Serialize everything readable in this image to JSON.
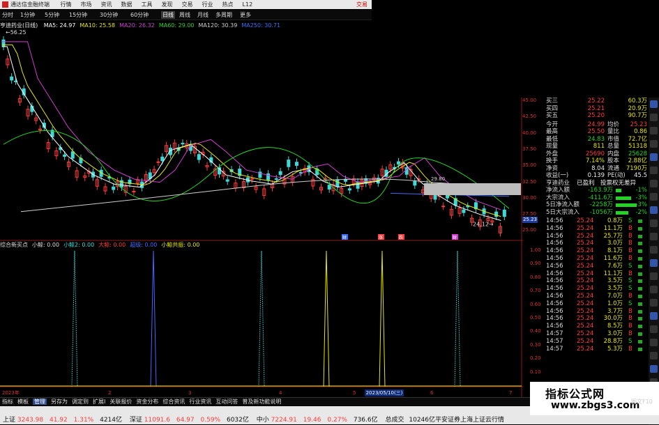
{
  "titlebar": {
    "app_title": "通达信金融终端",
    "trade": "交易"
  },
  "menu": [
    "行情",
    "市场",
    "资讯",
    "数据",
    "工具",
    "发现",
    "交易",
    "行业",
    "热点",
    "L12"
  ],
  "periods": [
    "分时",
    "1分钟",
    "5分钟",
    "15分钟",
    "30分钟",
    "60分钟",
    "日线",
    "周线",
    "月线",
    "多周期",
    "更多"
  ],
  "stock_label": "亨迪药业(日线)",
  "ma_legend": [
    {
      "label": "MA5: 24.97",
      "color": "#ffffff"
    },
    {
      "label": "MA10: 25.58",
      "color": "#e8e800"
    },
    {
      "label": "MA20: 26.32",
      "color": "#d23cd2"
    },
    {
      "label": "MA60: 29.00",
      "color": "#23d323"
    },
    {
      "label": "MA120: 30.39",
      "color": "#cfcfcf"
    },
    {
      "label": "MA250: 30.71",
      "color": "#3a6cff"
    }
  ],
  "high_label": "56.25",
  "low_label": "24.12",
  "hl_box_label": "29.80",
  "price_axis": [
    "45.00",
    "42.50",
    "40.00",
    "37.50",
    "35.00",
    "32.50",
    "30.00",
    "27.50",
    "25.00"
  ],
  "ind_axis": [
    "1.00",
    "0.90",
    "0.80",
    "0.70",
    "0.60",
    "0.50",
    "0.40",
    "0.30",
    "0.20",
    "0.10",
    "0.00"
  ],
  "current_price_tag": "25.23",
  "indicator_legend": [
    {
      "label": "综合新买点",
      "color": "#ddd"
    },
    {
      "label": "小鲸: 0.00",
      "color": "#ddd"
    },
    {
      "label": "小鲸2: 0.00",
      "color": "#3fd8d8"
    },
    {
      "label": "大鲸: 0.00",
      "color": "#ff3b3b"
    },
    {
      "label": "超级: 0.00",
      "color": "#3a6cff"
    },
    {
      "label": "小鲸共振: 0.00",
      "color": "#e8e800"
    }
  ],
  "month_labels": [
    "2023年",
    "2",
    "3",
    "4",
    "5",
    "6",
    "7"
  ],
  "date_box": "2023/05/10(三)",
  "event_marks": [
    "财",
    "涨",
    "跌",
    "财"
  ],
  "quote": {
    "asks": [
      [
        "买三",
        "25.22",
        "60.3万"
      ],
      [
        "买四",
        "25.21",
        "20.9万"
      ],
      [
        "买五",
        "25.20",
        "90.7万"
      ]
    ],
    "rows": [
      [
        "今开",
        "24.99",
        "均价",
        "25.23"
      ],
      [
        "最高",
        "25.50",
        "量比",
        "0.86"
      ],
      [
        "最低",
        "24.83",
        "市值",
        "72.7亿"
      ],
      [
        "现量",
        "811",
        "总量",
        "51318"
      ],
      [
        "外盘",
        "25690",
        "内盘",
        "25628"
      ],
      [
        "换手",
        "7.14%",
        "股本",
        "2.88亿"
      ],
      [
        "净资",
        "8.04",
        "流通",
        "7190万"
      ],
      [
        "收益(一)",
        "0.139",
        "PE(动)",
        "45.5"
      ]
    ],
    "stock_name": "亨迪药业",
    "profit": "已盈利",
    "vote": "投票权无差异",
    "flows": [
      [
        "净流入额",
        "-163.9万",
        "-1%"
      ],
      [
        "大宗流入",
        "-411.6万",
        "-3%"
      ],
      [
        "5日净流入额",
        "-2258万",
        "-3%"
      ],
      [
        "5日大宗流入",
        "-1056万",
        "-2%"
      ]
    ],
    "ticks": [
      [
        "14:56",
        "25.24",
        "0.8万",
        "S"
      ],
      [
        "14:56",
        "25.24",
        "11.1万",
        "B"
      ],
      [
        "14:56",
        "25.24",
        "25.7万",
        "B"
      ],
      [
        "14:56",
        "25.24",
        "3.0万",
        "B"
      ],
      [
        "14:56",
        "25.24",
        "8.1万",
        "B"
      ],
      [
        "14:56",
        "25.24",
        "11.6万",
        "B"
      ],
      [
        "14:56",
        "25.24",
        "7.6万",
        "S"
      ],
      [
        "14:56",
        "25.24",
        "11.1万",
        "B"
      ],
      [
        "14:56",
        "25.24",
        "3.5万",
        "S"
      ],
      [
        "14:56",
        "25.24",
        "3.5万",
        "S"
      ],
      [
        "14:56",
        "25.24",
        "7.0万",
        "B"
      ],
      [
        "14:56",
        "25.24",
        "1.0万",
        "S"
      ],
      [
        "14:56",
        "25.24",
        "3.7万",
        "B"
      ],
      [
        "14:56",
        "25.24",
        "30.0万",
        "B"
      ],
      [
        "14:56",
        "25.24",
        "8.5万",
        "B"
      ],
      [
        "14:57",
        "25.24",
        "3.0万",
        "B"
      ],
      [
        "14:57",
        "25.24",
        "28.8万",
        "S"
      ],
      [
        "14:57",
        "25.24",
        "5.3万",
        "B"
      ]
    ]
  },
  "bottom_tabs": [
    "指标",
    "模板",
    "管理",
    "另存为",
    "调定到",
    "扩展Ⅰ",
    "关联报价",
    "资金分布",
    "综合资讯",
    "行业资讯",
    "互动问答",
    "普及新功能说明"
  ],
  "bottom_active": "管理",
  "ticker": {
    "sh": {
      "name": "上证",
      "price": "3243.98",
      "chg": "41.92",
      "pct": "1.31%",
      "amt": "4214亿"
    },
    "sz": {
      "name": "深证",
      "price": "11091.6",
      "chg": "64.97",
      "pct": "0.59%",
      "amt": "6032亿"
    },
    "zx": {
      "name": "中小",
      "price": "7224.91",
      "chg": "19.46",
      "pct": "0.27%",
      "amt": "736.6亿"
    },
    "total": "总成交",
    "total_amt": "10246亿",
    "broker": "平安证券上海上证云行情"
  },
  "corner": "图文F10",
  "watermark": {
    "title": "指标公式网",
    "url": "www.zbgs3.com"
  }
}
